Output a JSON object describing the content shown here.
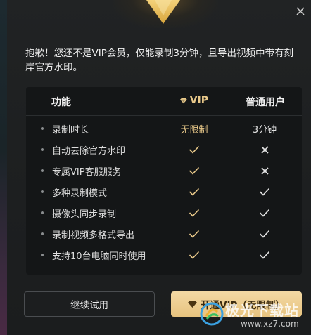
{
  "notice": "抱歉！您还不是VIP会员，仅能录制3分钟，且导出视频中带有刻岸官方水印。",
  "table": {
    "header": {
      "feature": "功能",
      "vip": "VIP",
      "normal": "普通用户"
    },
    "rows": [
      {
        "feature": "录制时长",
        "vip": "无限制",
        "normal": "3分钟"
      },
      {
        "feature": "自动去除官方水印",
        "vip": "check",
        "normal": "cross"
      },
      {
        "feature": "专属VIP客服服务",
        "vip": "check",
        "normal": "cross"
      },
      {
        "feature": "多种录制模式",
        "vip": "check",
        "normal": "check"
      },
      {
        "feature": "摄像头同步录制",
        "vip": "check",
        "normal": "check"
      },
      {
        "feature": "录制视频多格式导出",
        "vip": "check",
        "normal": "check"
      },
      {
        "feature": "支持10台电脑同时使用",
        "vip": "check",
        "normal": "check"
      }
    ]
  },
  "buttons": {
    "trial": "继续试用",
    "vip": "开通VIP（无限制）"
  },
  "watermark": {
    "brand": "极光下载站",
    "url": "www.xz7.com"
  },
  "colors": {
    "accent_gold": "#e9c98a",
    "button_gold": "#e7c37f",
    "background": "#1e2021"
  },
  "icons": {
    "close": "close-icon",
    "vip": "diamond-icon",
    "yes": "check-icon",
    "no": "cross-icon"
  }
}
